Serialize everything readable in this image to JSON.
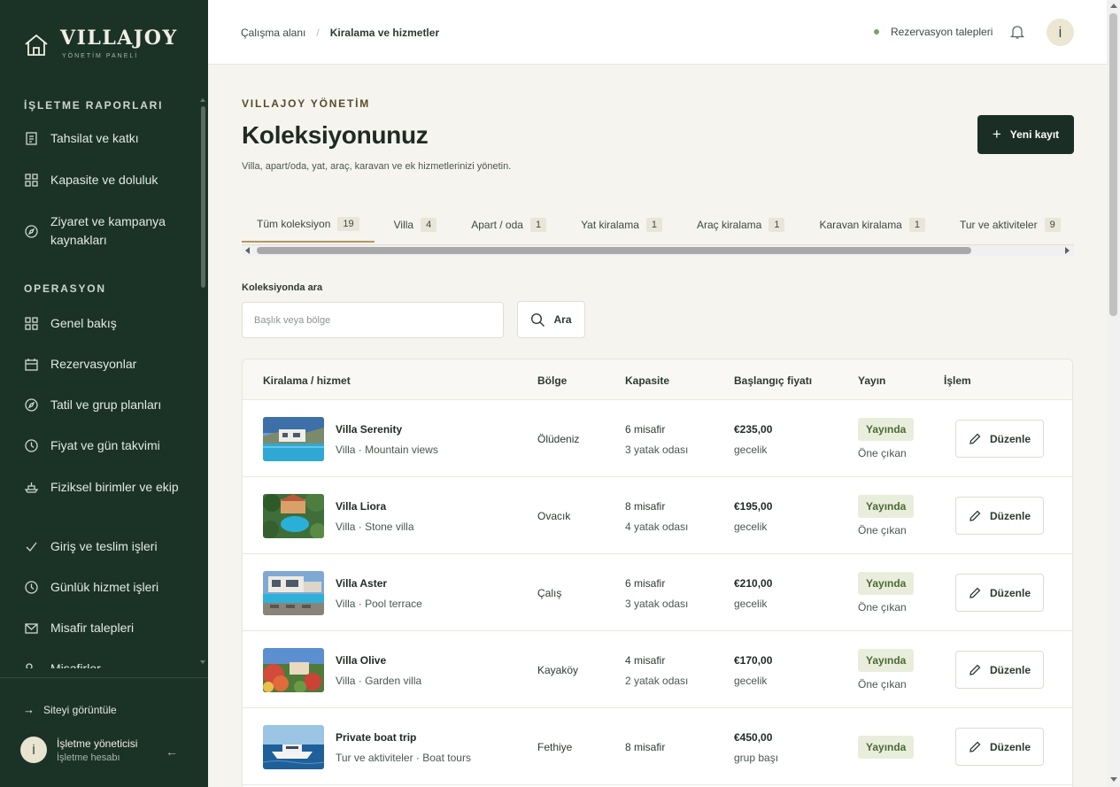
{
  "brand": {
    "name": "VILLAJOY",
    "subtitle": "YÖNETİM PANELİ"
  },
  "sidebar": {
    "sections": [
      {
        "title": "İŞLETME RAPORLARI",
        "items": [
          {
            "label": "Tahsilat ve katkı",
            "icon": "receipt-icon"
          },
          {
            "label": "Kapasite ve doluluk",
            "icon": "grid-icon"
          },
          {
            "label": "Ziyaret ve kampanya kaynakları",
            "icon": "compass-icon"
          }
        ]
      },
      {
        "title": "OPERASYON",
        "items": [
          {
            "label": "Genel bakış",
            "icon": "grid-icon"
          },
          {
            "label": "Rezervasyonlar",
            "icon": "calendar-icon"
          },
          {
            "label": "Tatil ve grup planları",
            "icon": "compass-icon"
          },
          {
            "label": "Fiyat ve gün takvimi",
            "icon": "clock-icon"
          },
          {
            "label": "Fiziksel birimler ve ekip",
            "icon": "boat-icon"
          },
          {
            "label": "Giriş ve teslim işleri",
            "icon": "check-icon"
          },
          {
            "label": "Günlük hizmet işleri",
            "icon": "clock-icon"
          },
          {
            "label": "Misafir talepleri",
            "icon": "mail-icon"
          },
          {
            "label": "Misafirler",
            "icon": "users-icon"
          }
        ]
      }
    ],
    "view_site": "Siteyi görüntüle",
    "user": {
      "initial": "İ",
      "name": "İşletme yöneticisi",
      "role": "İşletme hesabı"
    }
  },
  "topbar": {
    "breadcrumb": [
      "Çalışma alanı",
      "Kiralama ve hizmetler"
    ],
    "requests_label": "Rezervasyon talepleri",
    "avatar_initial": "İ"
  },
  "main": {
    "kicker": "VILLAJOY YÖNETİM",
    "title": "Koleksiyonunuz",
    "subtitle": "Villa, apart/oda, yat, araç, karavan ve ek hizmetlerinizi yönetin.",
    "new_button": "Yeni kayıt",
    "tabs": [
      {
        "label": "Tüm koleksiyon",
        "count": "19",
        "active": true
      },
      {
        "label": "Villa",
        "count": "4"
      },
      {
        "label": "Apart / oda",
        "count": "1"
      },
      {
        "label": "Yat kiralama",
        "count": "1"
      },
      {
        "label": "Araç kiralama",
        "count": "1"
      },
      {
        "label": "Karavan kiralama",
        "count": "1"
      },
      {
        "label": "Tur ve aktiviteler",
        "count": "9"
      }
    ],
    "search": {
      "label": "Koleksiyonda ara",
      "placeholder": "Başlık veya bölge",
      "button": "Ara"
    },
    "table": {
      "headers": [
        "Kiralama / hizmet",
        "Bölge",
        "Kapasite",
        "Başlangıç fiyatı",
        "Yayın",
        "İşlem"
      ],
      "rows": [
        {
          "title": "Villa Serenity",
          "sub": "Villa · Mountain views",
          "region": "Ölüdeniz",
          "cap1": "6 misafir",
          "cap2": "3 yatak odası",
          "price": "€235,00",
          "unit": "gecelik",
          "status": "Yayında",
          "featured": "Öne çıkan",
          "action": "Düzenle"
        },
        {
          "title": "Villa Liora",
          "sub": "Villa · Stone villa",
          "region": "Ovacık",
          "cap1": "8 misafir",
          "cap2": "4 yatak odası",
          "price": "€195,00",
          "unit": "gecelik",
          "status": "Yayında",
          "featured": "Öne çıkan",
          "action": "Düzenle"
        },
        {
          "title": "Villa Aster",
          "sub": "Villa · Pool terrace",
          "region": "Çalış",
          "cap1": "6 misafir",
          "cap2": "3 yatak odası",
          "price": "€210,00",
          "unit": "gecelik",
          "status": "Yayında",
          "featured": "Öne çıkan",
          "action": "Düzenle"
        },
        {
          "title": "Villa Olive",
          "sub": "Villa · Garden villa",
          "region": "Kayaköy",
          "cap1": "4 misafir",
          "cap2": "2 yatak odası",
          "price": "€170,00",
          "unit": "gecelik",
          "status": "Yayında",
          "featured": "Öne çıkan",
          "action": "Düzenle"
        },
        {
          "title": "Private boat trip",
          "sub": "Tur ve aktiviteler · Boat tours",
          "region": "Fethiye",
          "cap1": "8 misafir",
          "cap2": "",
          "price": "€450,00",
          "unit": "grup başı",
          "status": "Yayında",
          "featured": "",
          "action": "Düzenle"
        }
      ]
    }
  }
}
